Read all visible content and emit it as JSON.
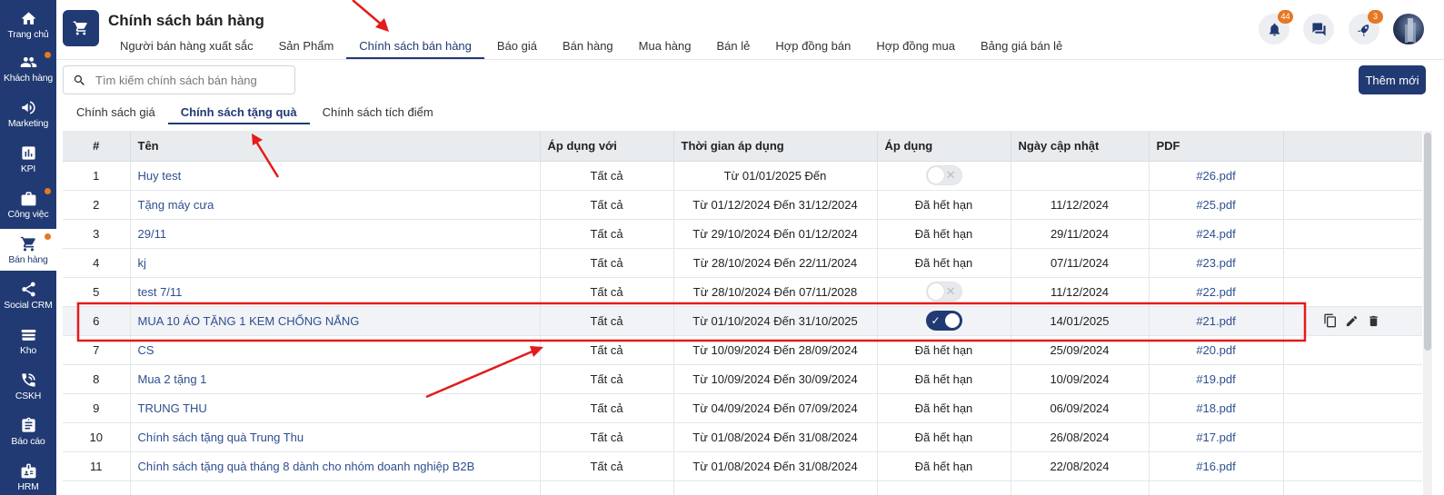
{
  "sidebar": {
    "items": [
      {
        "label": "Trang chủ",
        "icon": "home-icon",
        "dot": false
      },
      {
        "label": "Khách hàng",
        "icon": "users-icon",
        "dot": true
      },
      {
        "label": "Marketing",
        "icon": "megaphone-icon",
        "dot": false
      },
      {
        "label": "KPI",
        "icon": "chart-icon",
        "dot": false
      },
      {
        "label": "Công việc",
        "icon": "briefcase-icon",
        "dot": true
      },
      {
        "label": "Bán hàng",
        "icon": "cart-icon",
        "dot": true,
        "active": true
      },
      {
        "label": "Social CRM",
        "icon": "share-icon",
        "dot": false
      },
      {
        "label": "Kho",
        "icon": "warehouse-icon",
        "dot": false
      },
      {
        "label": "CSKH",
        "icon": "phone-icon",
        "dot": false
      },
      {
        "label": "Báo cáo",
        "icon": "clipboard-icon",
        "dot": false
      },
      {
        "label": "HRM",
        "icon": "badge-icon",
        "dot": false
      }
    ]
  },
  "header": {
    "title": "Chính sách bán hàng",
    "notifications_count": "44",
    "rocket_count": "3",
    "tabs": [
      {
        "label": "Người bán hàng xuất sắc"
      },
      {
        "label": "Sản Phẩm"
      },
      {
        "label": "Chính sách bán hàng",
        "active": true
      },
      {
        "label": "Báo giá"
      },
      {
        "label": "Bán hàng"
      },
      {
        "label": "Mua hàng"
      },
      {
        "label": "Bán lẻ"
      },
      {
        "label": "Hợp đồng bán"
      },
      {
        "label": "Hợp đồng mua"
      },
      {
        "label": "Bảng giá bán lẻ"
      }
    ]
  },
  "search": {
    "placeholder": "Tìm kiếm chính sách bán hàng",
    "value": ""
  },
  "add_button": "Thêm mới",
  "sub_tabs": [
    {
      "label": "Chính sách giá"
    },
    {
      "label": "Chính sách tặng quà",
      "active": true
    },
    {
      "label": "Chính sách tích điểm"
    }
  ],
  "table": {
    "columns": [
      "#",
      "Tên",
      "Áp dụng với",
      "Thời gian áp dụng",
      "Áp dụng",
      "Ngày cập nhật",
      "PDF"
    ],
    "rows": [
      {
        "num": "1",
        "name": "Huy test",
        "apply_to": "Tất cả",
        "period": "Từ 01/01/2025 Đến",
        "status": "toggle-off",
        "updated": "",
        "pdf": "#26.pdf"
      },
      {
        "num": "2",
        "name": "Tặng máy cưa",
        "apply_to": "Tất cả",
        "period": "Từ 01/12/2024 Đến 31/12/2024",
        "status": "Đã hết hạn",
        "updated": "11/12/2024",
        "pdf": "#25.pdf"
      },
      {
        "num": "3",
        "name": "29/11",
        "apply_to": "Tất cả",
        "period": "Từ 29/10/2024 Đến 01/12/2024",
        "status": "Đã hết hạn",
        "updated": "29/11/2024",
        "pdf": "#24.pdf"
      },
      {
        "num": "4",
        "name": "kj",
        "apply_to": "Tất cả",
        "period": "Từ 28/10/2024 Đến 22/11/2024",
        "status": "Đã hết hạn",
        "updated": "07/11/2024",
        "pdf": "#23.pdf"
      },
      {
        "num": "5",
        "name": "test 7/11",
        "apply_to": "Tất cả",
        "period": "Từ 28/10/2024 Đến 07/11/2028",
        "status": "toggle-off",
        "updated": "11/12/2024",
        "pdf": "#22.pdf"
      },
      {
        "num": "6",
        "name": "MUA 10 ÁO TẶNG 1 KEM CHỐNG NẮNG",
        "apply_to": "Tất cả",
        "period": "Từ 01/10/2024 Đến 31/10/2025",
        "status": "toggle-on",
        "updated": "14/01/2025",
        "pdf": "#21.pdf",
        "highlight": true
      },
      {
        "num": "7",
        "name": "CS",
        "apply_to": "Tất cả",
        "period": "Từ 10/09/2024 Đến 28/09/2024",
        "status": "Đã hết hạn",
        "updated": "25/09/2024",
        "pdf": "#20.pdf"
      },
      {
        "num": "8",
        "name": "Mua 2 tặng 1",
        "apply_to": "Tất cả",
        "period": "Từ 10/09/2024 Đến 30/09/2024",
        "status": "Đã hết hạn",
        "updated": "10/09/2024",
        "pdf": "#19.pdf"
      },
      {
        "num": "9",
        "name": "TRUNG THU",
        "apply_to": "Tất cả",
        "period": "Từ 04/09/2024 Đến 07/09/2024",
        "status": "Đã hết hạn",
        "updated": "06/09/2024",
        "pdf": "#18.pdf"
      },
      {
        "num": "10",
        "name": "Chính sách tặng quà Trung Thu",
        "apply_to": "Tất cả",
        "period": "Từ 01/08/2024 Đến 31/08/2024",
        "status": "Đã hết hạn",
        "updated": "26/08/2024",
        "pdf": "#17.pdf"
      },
      {
        "num": "11",
        "name": "Chính sách tặng quà tháng 8 dành cho nhóm doanh nghiệp B2B",
        "apply_to": "Tất cả",
        "period": "Từ 01/08/2024 Đến 31/08/2024",
        "status": "Đã hết hạn",
        "updated": "22/08/2024",
        "pdf": "#16.pdf"
      },
      {
        "num": "",
        "name": "",
        "apply_to": "",
        "period": "",
        "status": "",
        "updated": "",
        "pdf": ""
      }
    ]
  },
  "colors": {
    "primary": "#213a73",
    "accent": "#e87722",
    "annotation": "#e31b1b",
    "link": "#2e4f8f"
  }
}
